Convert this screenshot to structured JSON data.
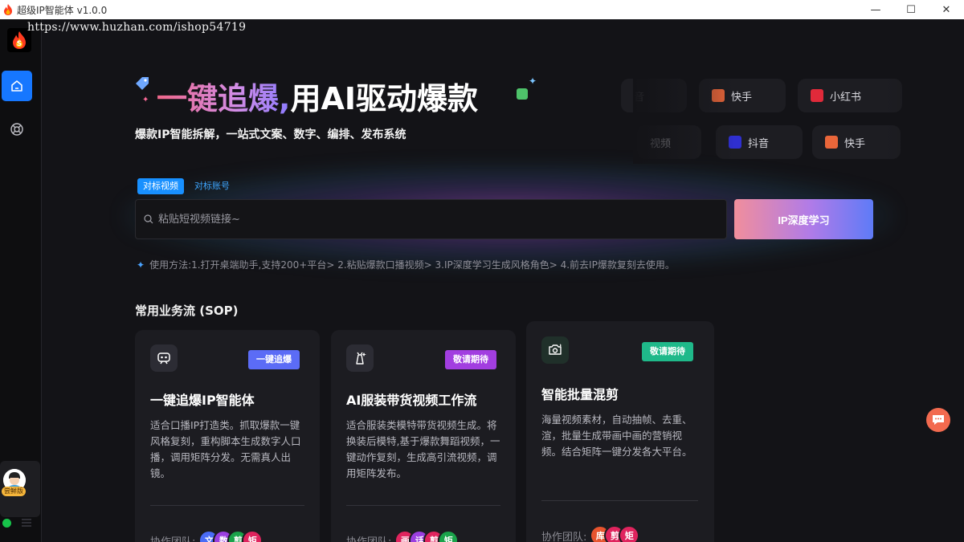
{
  "window": {
    "title": "超级IP智能体 v1.0.0",
    "controls": {
      "minimize": "—",
      "maximize": "☐",
      "close": "✕"
    }
  },
  "watermark": "https://www.huzhan.com/ishop54719",
  "sidebar": {
    "nav": [
      {
        "name": "home",
        "icon": "home-icon"
      },
      {
        "name": "support",
        "icon": "lifebuoy-icon"
      }
    ],
    "user": {
      "badge": "尝鲜版"
    }
  },
  "hero": {
    "title_highlight": "一键追爆,",
    "title_rest": "用AI驱动爆款",
    "subtitle": "爆款IP智能拆解，一站式文案、数字、编排、发布系统"
  },
  "platforms": [
    {
      "label": "音",
      "color": "#1d1d22"
    },
    {
      "label": "快手",
      "color": "#e9663a"
    },
    {
      "label": "小红书",
      "color": "#e02a3a"
    },
    {
      "label": "视频",
      "color": "#f5a623"
    },
    {
      "label": "抖音",
      "color": "#2f2fd0"
    },
    {
      "label": "快手",
      "color": "#e9663a"
    }
  ],
  "search": {
    "tabs": [
      "对标视频",
      "对标账号"
    ],
    "placeholder": "粘贴短视频链接~",
    "button": "IP深度学习",
    "usage": "使用方法:1.打开桌端助手,支持200+平台> 2.粘贴爆款口播视频> 3.IP深度学习生成风格角色> 4.前去IP爆款复刻去使用。"
  },
  "sop": {
    "title": "常用业务流 (SOP)",
    "team_label": "协作团队:",
    "cards": [
      {
        "badge": "一键追爆",
        "badge_color": "#5b6cf6",
        "title": "一键追爆IP智能体",
        "desc": "适合口播IP打造类。抓取爆款一键风格复刻，重构脚本生成数字人口播，调用矩阵分发。无需真人出镜。",
        "team": [
          {
            "t": "文",
            "c": "#4a6cf7"
          },
          {
            "t": "数",
            "c": "#9b3fe0"
          },
          {
            "t": "剪",
            "c": "#1aa34a"
          },
          {
            "t": "矩",
            "c": "#e0245e"
          }
        ]
      },
      {
        "badge": "敬请期待",
        "badge_color": "#a23ee0",
        "title": "AI服装带货视频工作流",
        "desc": "适合服装类模特带货视频生成。将换装后模特,基于爆款舞蹈视频，一键动作复刻，生成高引流视频，调用矩阵发布。",
        "team": [
          {
            "t": "画",
            "c": "#e0245e"
          },
          {
            "t": "话",
            "c": "#9b3fe0"
          },
          {
            "t": "剪",
            "c": "#e0245e"
          },
          {
            "t": "矩",
            "c": "#1aa34a"
          }
        ]
      },
      {
        "badge": "敬请期待",
        "badge_color": "#1fb98a",
        "title": "智能批量混剪",
        "desc": "海量视频素材，自动抽帧、去重、渲，批量生成带画中画的营销视频。结合矩阵一键分发各大平台。",
        "team": [
          {
            "t": "库",
            "c": "#e8542e"
          },
          {
            "t": "剪",
            "c": "#e0245e"
          },
          {
            "t": "矩",
            "c": "#e0245e"
          }
        ]
      }
    ]
  }
}
